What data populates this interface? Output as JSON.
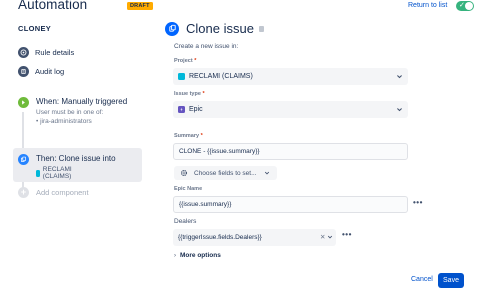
{
  "header": {
    "app_title": "Automation",
    "draft_badge": "DRAFT",
    "return_link": "Return to list",
    "enabled_toggle": true
  },
  "sidebar": {
    "rule_name": "CLONEY",
    "nav": [
      {
        "label": "Rule details",
        "icon": "info-icon"
      },
      {
        "label": "Audit log",
        "icon": "audit-log-icon"
      }
    ],
    "trigger": {
      "title": "When: Manually triggered",
      "sub": "User must be in one of:",
      "bullet": "• jira-administrators",
      "icon": "trigger-icon"
    },
    "action": {
      "title": "Then: Clone issue into",
      "project": "RECLAMI (CLAIMS)",
      "icon": "clone-icon"
    },
    "add_component": "Add component"
  },
  "panel": {
    "title": "Clone issue",
    "section": "Create a new issue in:",
    "project": {
      "label": "Project",
      "value": "RECLAMI (CLAIMS)"
    },
    "issue_type": {
      "label": "Issue type",
      "value": "Epic"
    },
    "summary": {
      "label": "Summary",
      "value": "CLONE - {{issue.summary}}"
    },
    "choose_fields": "Choose fields to set...",
    "epic_name": {
      "label": "Epic Name",
      "value": "{{issue.summary}}"
    },
    "dealers": {
      "label": "Dealers",
      "value": "{{triggerIssue.fields.Dealers}}"
    },
    "more_options": "More options",
    "cancel_label": "Cancel",
    "save_label": "Save"
  },
  "colors": {
    "primary": "#0052cc",
    "toggle_on": "#36b37e",
    "draft": "#ffab00",
    "trigger": "#6fbb3b",
    "action": "#2684ff",
    "required": "#de350b"
  }
}
